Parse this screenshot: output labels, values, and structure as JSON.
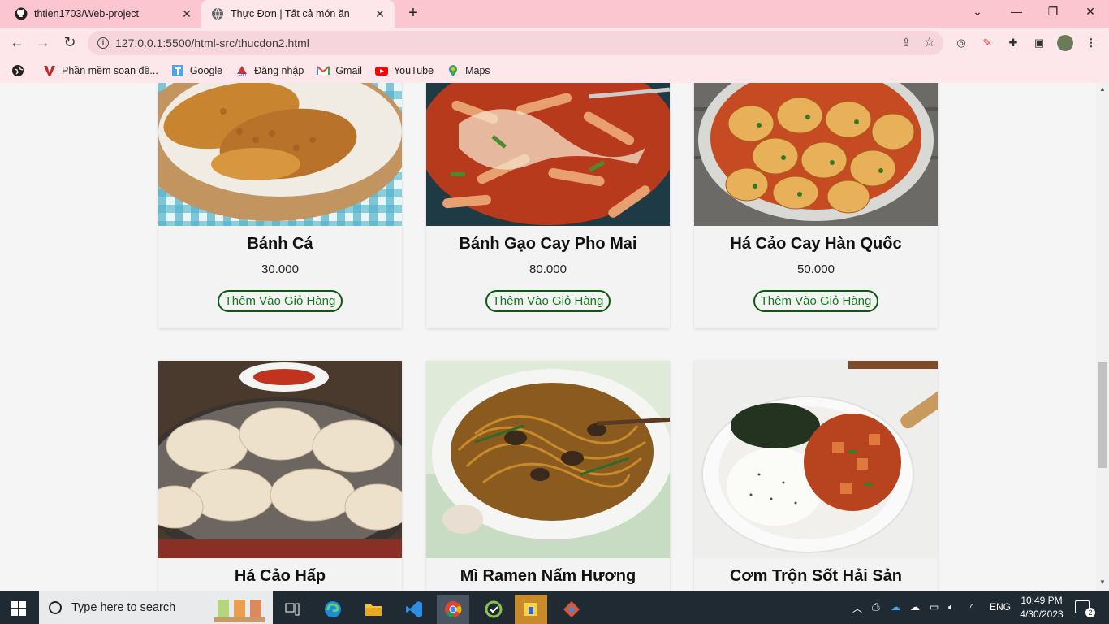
{
  "browser": {
    "tabs": [
      {
        "title": "thtien1703/Web-project",
        "icon": "github-icon"
      },
      {
        "title": "Thực Đơn | Tất cả món ăn",
        "icon": "globe-icon"
      }
    ],
    "url": "127.0.0.1:5500/html-src/thucdon2.html",
    "bookmarks": [
      {
        "label": "Phần mềm soạn đề...",
        "icon": "v-logo-icon"
      },
      {
        "label": "Google",
        "icon": "google-icon"
      },
      {
        "label": "Đăng nhập",
        "icon": "login-icon"
      },
      {
        "label": "Gmail",
        "icon": "gmail-icon"
      },
      {
        "label": "YouTube",
        "icon": "youtube-icon"
      },
      {
        "label": "Maps",
        "icon": "maps-icon"
      }
    ]
  },
  "menu": {
    "cart_label": "Thêm Vào Giỏ Hàng",
    "items": [
      {
        "name": "Bánh Cá",
        "price": "30.000"
      },
      {
        "name": "Bánh Gạo Cay Pho Mai",
        "price": "80.000"
      },
      {
        "name": "Há Cảo Cay Hàn Quốc",
        "price": "50.000"
      },
      {
        "name": "Há Cảo Hấp"
      },
      {
        "name": "Mì Ramen Nấm Hương"
      },
      {
        "name": "Cơm Trộn Sốt Hải Sản"
      }
    ]
  },
  "taskbar": {
    "search_placeholder": "Type here to search",
    "language": "ENG",
    "time": "10:49 PM",
    "date": "4/30/2023",
    "notifications": "2"
  },
  "colors": {
    "tab_strip": "#fbc6cf",
    "toolbar": "#fde7eb",
    "button_border": "#0c5a12",
    "button_text": "#0f7a1c",
    "taskbar": "#1f2a33"
  }
}
